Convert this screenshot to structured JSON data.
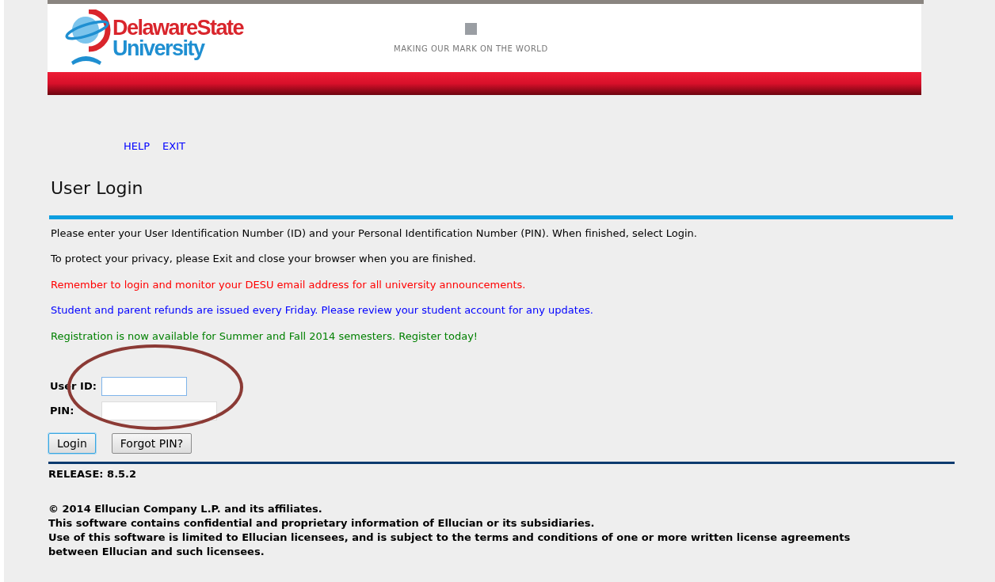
{
  "header": {
    "logo_line_1": "DelawareState",
    "logo_line_2": "University",
    "tagline": "MAKING OUR MARK ON THE WORLD"
  },
  "nav_links": [
    "HELP",
    "EXIT"
  ],
  "title": "User Login",
  "messages": [
    {
      "text": "Please enter your User Identification Number (ID) and your Personal Identification Number (PIN). When finished, select Login.",
      "color": "#000000"
    },
    {
      "text": "To protect your privacy, please Exit and close your browser when you are finished.",
      "color": "#000000"
    },
    {
      "text": "Remember to login and monitor your DESU email address for all university announcements.",
      "color": "#ff0000"
    },
    {
      "text": "Student and parent refunds are issued every Friday. Please review your student account for any updates.",
      "color": "#0000ff"
    },
    {
      "text": "Registration is now available for Summer and Fall 2014 semesters. Register today!",
      "color": "#008000"
    }
  ],
  "form": {
    "fields": [
      {
        "label": "User ID:",
        "focused": true
      },
      {
        "label": "PIN:",
        "focused": false
      }
    ],
    "buttons": [
      {
        "label": "Login",
        "focused": true
      },
      {
        "label": "Forgot PIN?",
        "focused": false
      }
    ]
  },
  "release": "RELEASE: 8.5.2",
  "footer": [
    "© 2014 Ellucian Company L.P. and its affiliates.",
    "This software contains confidential and proprietary information of Ellucian or its subsidiaries.",
    "Use of this software is limited to Ellucian licensees, and is subject to the terms and conditions of one or more written license agreements between Ellucian and such licensees."
  ]
}
